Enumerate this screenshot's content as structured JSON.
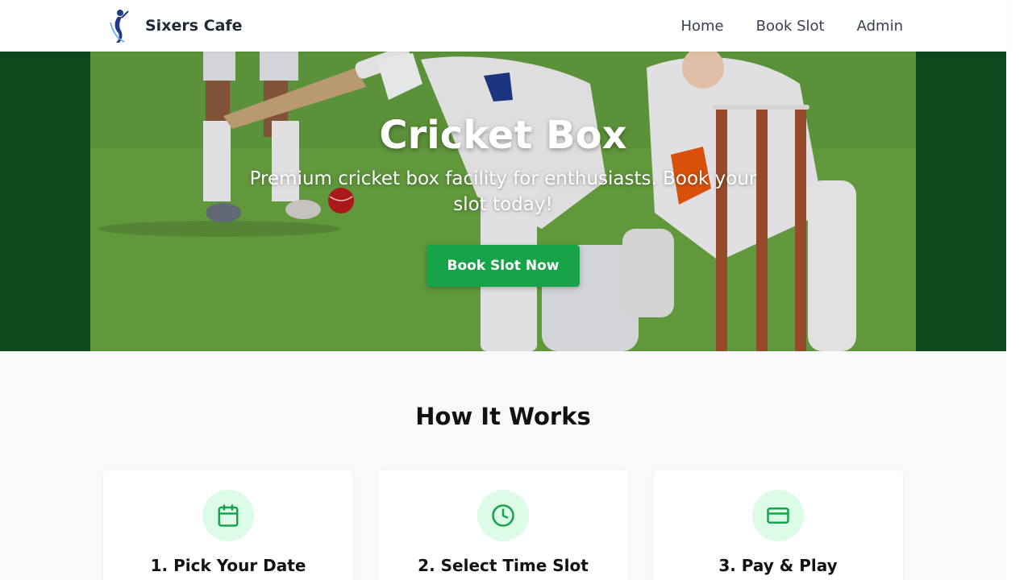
{
  "header": {
    "brand_name": "Sixers Cafe",
    "logo_icon": "cricket-player-logo-icon",
    "nav": [
      {
        "label": "Home"
      },
      {
        "label": "Book Slot"
      },
      {
        "label": "Admin"
      }
    ]
  },
  "hero": {
    "title": "Cricket Box",
    "subtitle": "Premium cricket box facility for enthusiasts. Book your slot today!",
    "cta_label": "Book Slot Now",
    "background_image": "cricket-match-photo"
  },
  "how_it_works": {
    "title": "How It Works",
    "steps": [
      {
        "title": "1. Pick Your Date",
        "icon": "calendar-icon"
      },
      {
        "title": "2. Select Time Slot",
        "icon": "clock-icon"
      },
      {
        "title": "3. Pay & Play",
        "icon": "credit-card-icon"
      }
    ]
  },
  "colors": {
    "accent": "#16a34a",
    "hero_band": "#0c4a1e",
    "icon_bg": "#dcfce7",
    "text_dark": "#1f2937"
  }
}
